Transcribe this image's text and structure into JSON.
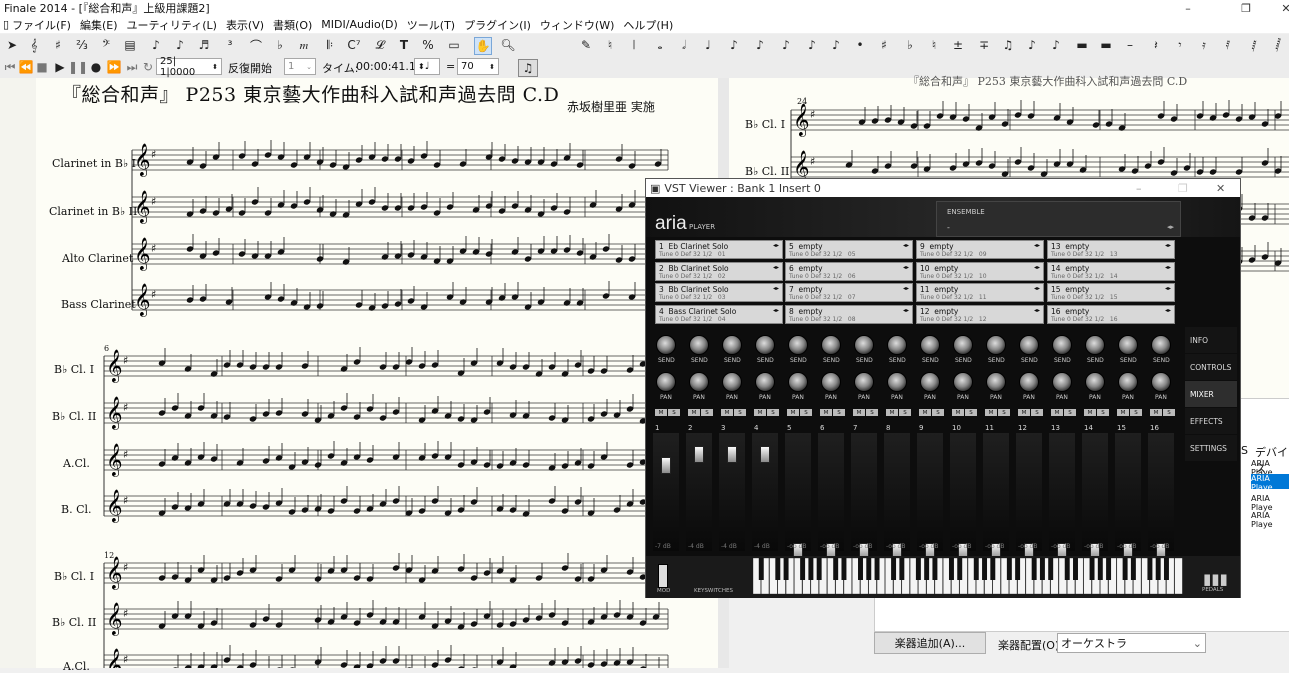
{
  "window": {
    "title": "Finale 2014 - [『総合和声』上級用課題2]",
    "min": "–",
    "max": "❐",
    "close": "✕"
  },
  "menu": [
    "ファイル(F)",
    "編集(E)",
    "ユーティリティ(L)",
    "表示(V)",
    "書類(O)",
    "MIDI/Audio(D)",
    "ツール(T)",
    "プラグイン(I)",
    "ウィンドウ(W)",
    "ヘルプ(H)"
  ],
  "playback": {
    "measure": "25| 1|0000",
    "repeat_label": "反復開始",
    "repeat_value": "1",
    "time_label": "タイム:",
    "time_value": "00:00:41.143",
    "tempo_eq": "=",
    "tempo": "70"
  },
  "score": {
    "title": "『総合和声』 P253 東京藝大作曲科入試和声過去問 C.D",
    "author": "赤坂樹里亜 実施",
    "right_title": "『総合和声』 P253 東京藝大作曲科入試和声過去問 C.D",
    "sys1_labels": [
      "Clarinet in B♭ I",
      "Clarinet in B♭ II",
      "Alto Clarinet",
      "Bass Clarinet"
    ],
    "sys2_labels": [
      "B♭ Cl. I",
      "B♭ Cl. II",
      "A.Cl.",
      "B. Cl."
    ],
    "sys3_labels": [
      "B♭ Cl. I",
      "B♭ Cl. II",
      "A.Cl."
    ],
    "right_labels": [
      "B♭ Cl. I",
      "B♭ Cl. II"
    ],
    "m6": "6",
    "m12": "12",
    "m24": "24"
  },
  "vst": {
    "title": "VST Viewer : Bank 1 Insert 0",
    "logo": "aria",
    "logo_sub": "PLAYER",
    "ensemble_label": "ENSEMBLE",
    "ensemble_value": "-",
    "slots": [
      {
        "n": "1",
        "name": "Eb Clarinet Solo",
        "ch": "01"
      },
      {
        "n": "2",
        "name": "Bb Clarinet Solo",
        "ch": "02"
      },
      {
        "n": "3",
        "name": "Bb Clarinet Solo",
        "ch": "03"
      },
      {
        "n": "4",
        "name": "Bass Clarinet Solo",
        "ch": "04"
      },
      {
        "n": "5",
        "name": "empty",
        "ch": "05"
      },
      {
        "n": "6",
        "name": "empty",
        "ch": "06"
      },
      {
        "n": "7",
        "name": "empty",
        "ch": "07"
      },
      {
        "n": "8",
        "name": "empty",
        "ch": "08"
      },
      {
        "n": "9",
        "name": "empty",
        "ch": "09"
      },
      {
        "n": "10",
        "name": "empty",
        "ch": "10"
      },
      {
        "n": "11",
        "name": "empty",
        "ch": "11"
      },
      {
        "n": "12",
        "name": "empty",
        "ch": "12"
      },
      {
        "n": "13",
        "name": "empty",
        "ch": "13"
      },
      {
        "n": "14",
        "name": "empty",
        "ch": "14"
      },
      {
        "n": "15",
        "name": "empty",
        "ch": "15"
      },
      {
        "n": "16",
        "name": "empty",
        "ch": "16"
      }
    ],
    "slot_sub": "Tune   0  Def   32  1/2",
    "send": "SEND",
    "pan": "PAN",
    "mute": "M",
    "solo": "S",
    "db_values": [
      "-7 dB",
      "-4 dB",
      "-4 dB",
      "-4 dB",
      "-oo dB",
      "-oo dB",
      "-oo dB",
      "-oo dB",
      "-oo dB",
      "-oo dB",
      "-oo dB",
      "-oo dB",
      "-oo dB",
      "-oo dB",
      "-oo dB",
      "-oo dB"
    ],
    "fader_levels": [
      0.78,
      0.88,
      0.88,
      0.88,
      0,
      0,
      0,
      0,
      0,
      0,
      0,
      0,
      0,
      0,
      0,
      0
    ],
    "tabs": [
      "INFO",
      "CONTROLS",
      "MIXER",
      "EFFECTS",
      "SETTINGS"
    ],
    "active_tab": "MIXER",
    "mod": "MOD",
    "keyswitches": "KEYSWITCHES",
    "pedals": "PEDALS"
  },
  "dialog": {
    "col_s": "S",
    "col_device": "デバイス",
    "devices": [
      "ARIA Playe",
      "ARIA Playe",
      "ARIA Playe",
      "ARIA Playe"
    ],
    "add_button": "楽器追加(A)...",
    "layout_label": "楽器配置(O)",
    "layout_value": "オーケストラ"
  }
}
